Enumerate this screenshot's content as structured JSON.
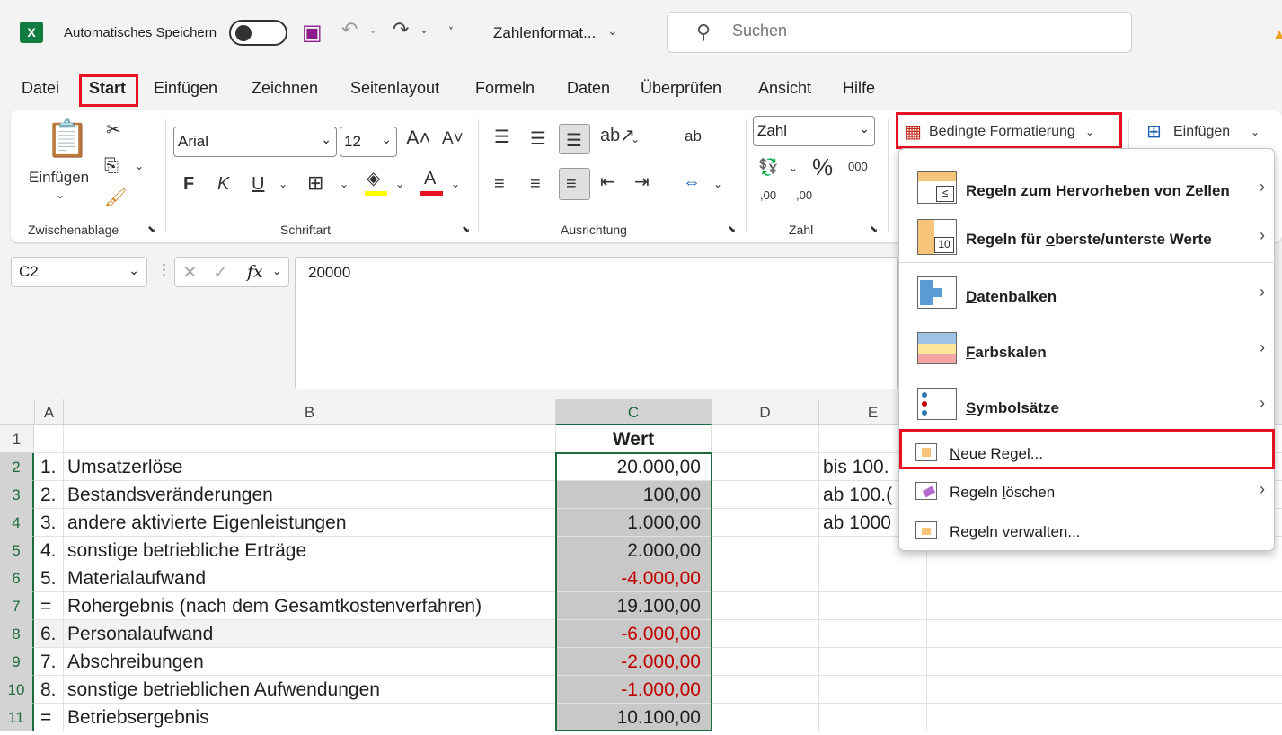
{
  "titlebar": {
    "app_icon": "X",
    "autosave_label": "Automatisches Speichern",
    "filename": "Zahlenformat...",
    "search_placeholder": "Suchen"
  },
  "menu_tabs": [
    "Datei",
    "Start",
    "Einfügen",
    "Zeichnen",
    "Seitenlayout",
    "Formeln",
    "Daten",
    "Überprüfen",
    "Ansicht",
    "Hilfe"
  ],
  "active_tab": "Start",
  "ribbon": {
    "paste_label": "Einfügen",
    "font_name": "Arial",
    "font_size": "12",
    "bold": "F",
    "italic": "K",
    "underline": "U",
    "number_format": "Zahl",
    "percent": "%",
    "thousands": "000",
    "dec_inc": ",00",
    "dec_dec": ",00",
    "wrap_text": "ab",
    "cond_format": "Bedingte Formatierung",
    "insert_cells": "Einfügen",
    "groups": {
      "clipboard": "Zwischenablage",
      "font": "Schriftart",
      "alignment": "Ausrichtung",
      "number": "Zahl"
    },
    "colors": {
      "highlight": "#ffff00",
      "font_color": "#e81123",
      "accent": "#107c41"
    }
  },
  "formula_bar": {
    "name_box": "C2",
    "fx": "fx",
    "value": "20000"
  },
  "grid": {
    "columns": [
      "A",
      "B",
      "C",
      "D",
      "E"
    ],
    "rows": [
      {
        "n": "1",
        "a": "",
        "b": "",
        "c": "Wert",
        "e": ""
      },
      {
        "n": "2",
        "a": "1.",
        "b": "Umsatzerlöse",
        "c": "20.000,00",
        "e": "bis 100."
      },
      {
        "n": "3",
        "a": "2.",
        "b": "Bestandsveränderungen",
        "c": "100,00",
        "e": "ab 100.("
      },
      {
        "n": "4",
        "a": "3.",
        "b": "andere aktivierte Eigenleistungen",
        "c": "1.000,00",
        "e": "ab 1000"
      },
      {
        "n": "5",
        "a": "4.",
        "b": "sonstige betriebliche Erträge",
        "c": "2.000,00",
        "e": ""
      },
      {
        "n": "6",
        "a": "5.",
        "b": "Materialaufwand",
        "c": "-4.000,00",
        "e": ""
      },
      {
        "n": "7",
        "a": "=",
        "b": "Rohergebnis (nach dem Gesamtkostenverfahren)",
        "c": "19.100,00",
        "e": ""
      },
      {
        "n": "8",
        "a": "6.",
        "b": "Personalaufwand",
        "c": "-6.000,00",
        "e": ""
      },
      {
        "n": "9",
        "a": "7.",
        "b": "Abschreibungen",
        "c": "-2.000,00",
        "e": ""
      },
      {
        "n": "10",
        "a": "8.",
        "b": "sonstige betrieblichen Aufwendungen",
        "c": "-1.000,00",
        "e": ""
      },
      {
        "n": "11",
        "a": "=",
        "b": "Betriebsergebnis",
        "c": "10.100,00",
        "e": ""
      }
    ]
  },
  "dropdown": {
    "items": [
      {
        "pre": "Regeln zum ",
        "u": "H",
        "post": "ervorheben von Zellen"
      },
      {
        "pre": "Regeln für ",
        "u": "o",
        "post": "berste/unterste Werte"
      },
      {
        "pre": "",
        "u": "D",
        "post": "atenbalken"
      },
      {
        "pre": "",
        "u": "F",
        "post": "arbskalen"
      },
      {
        "pre": "",
        "u": "S",
        "post": "ymbolsätze"
      }
    ],
    "small_items": [
      {
        "pre": "",
        "u": "N",
        "post": "eue Regel..."
      },
      {
        "pre": "Regeln ",
        "u": "l",
        "post": "öschen"
      },
      {
        "pre": "",
        "u": "R",
        "post": "egeln verwalten..."
      }
    ],
    "icon_number": "10",
    "icon_le": "≤"
  }
}
